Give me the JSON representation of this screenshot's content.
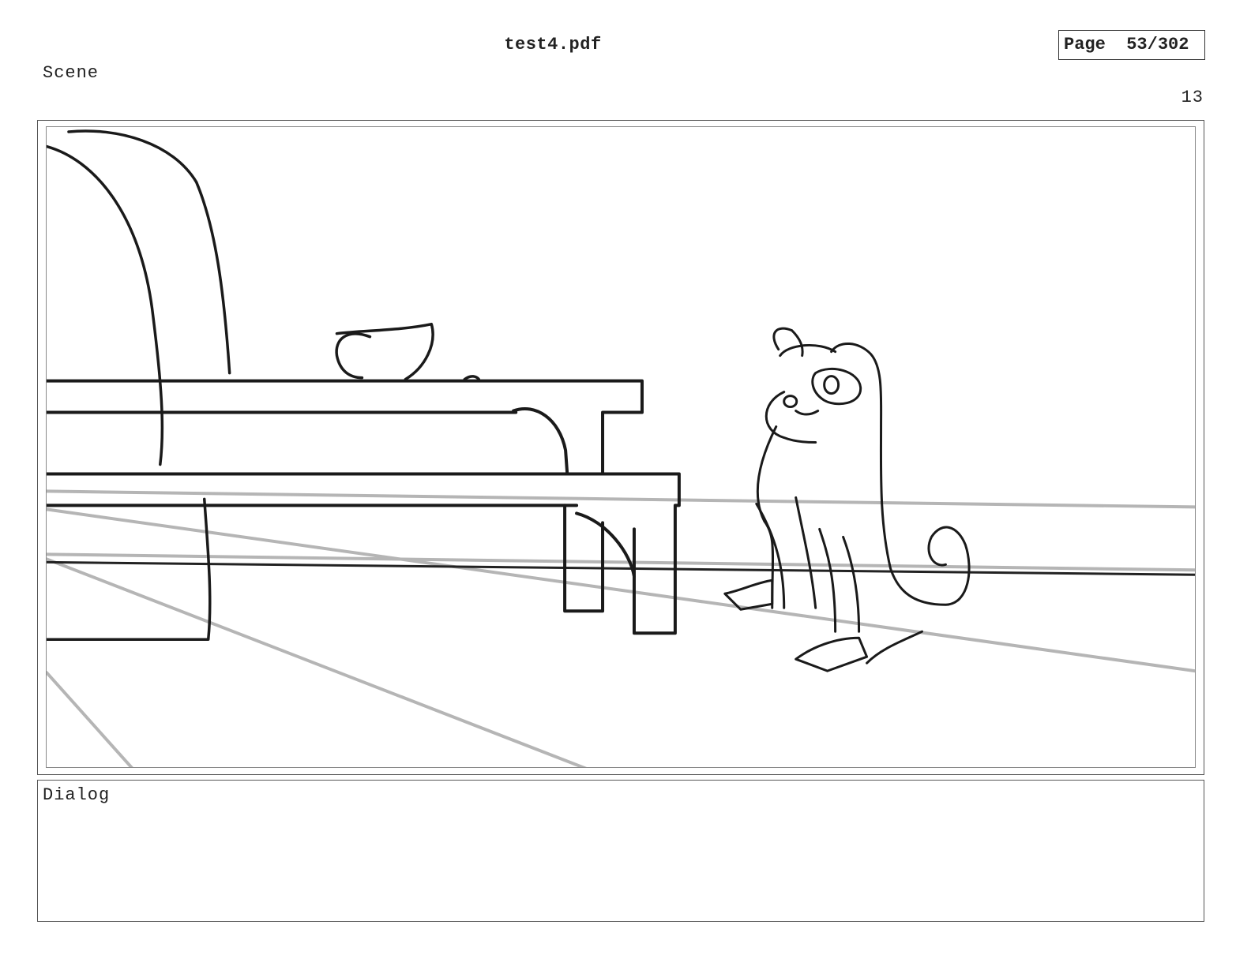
{
  "header": {
    "file_title": "test4.pdf",
    "page_indicator": "Page  53/302"
  },
  "scene": {
    "label": "Scene",
    "number": "13"
  },
  "panel": {
    "drawing_subject": "sketch-of-cat-near-table"
  },
  "dialog": {
    "label": "Dialog",
    "text": ""
  }
}
